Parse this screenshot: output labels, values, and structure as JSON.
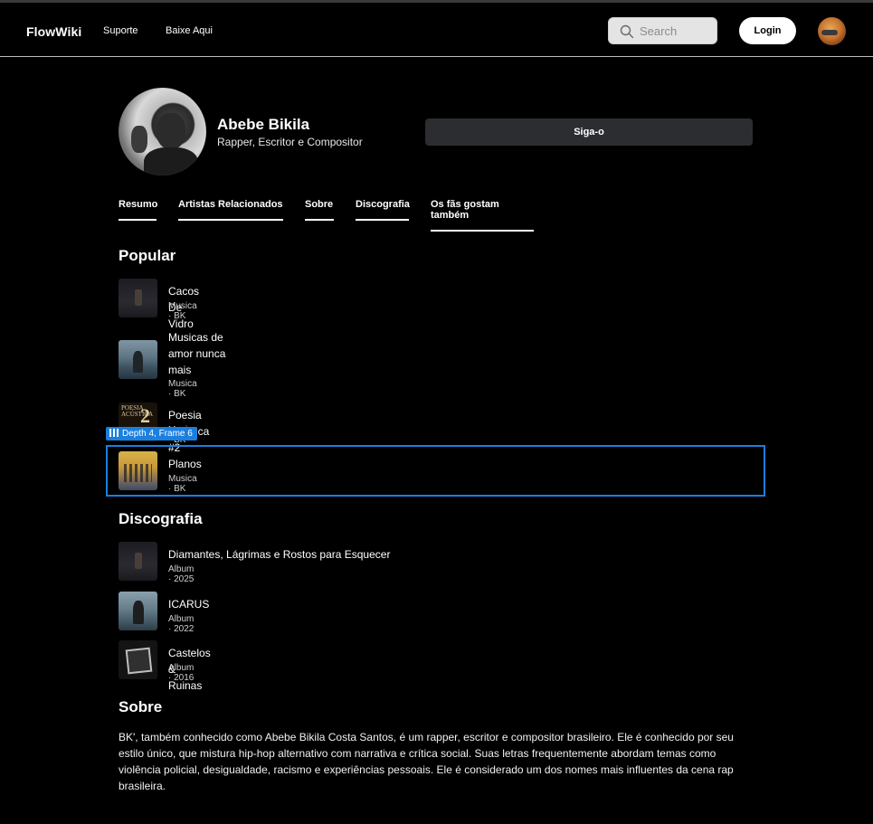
{
  "header": {
    "logo": "FlowWiki",
    "nav": [
      "Suporte",
      "Baixe Aqui"
    ],
    "search_placeholder": "Search",
    "login_label": "Login"
  },
  "profile": {
    "name": "Abebe Bikila",
    "role": "Rapper, Escritor e Compositor",
    "follow_label": "Siga-o"
  },
  "tabs": [
    "Resumo",
    "Artistas Relacionados",
    "Sobre",
    "Discografia",
    "Os fãs gostam também"
  ],
  "popular": {
    "title": "Popular",
    "items": [
      {
        "title": "Cacos De Vidro",
        "subtitle": "Musica · BK"
      },
      {
        "title": "Musicas de amor nunca mais",
        "subtitle": "Musica · BK"
      },
      {
        "title": "Poesia Acústica #2",
        "subtitle": "Musica · BK",
        "cover_text": "POESIA ACÚSTICA",
        "cover_number": "2"
      },
      {
        "title": "Planos",
        "subtitle": "Musica · BK"
      }
    ]
  },
  "selection_badge": "Depth 4, Frame 6",
  "discography": {
    "title": "Discografia",
    "items": [
      {
        "title": "Diamantes, Lágrimas e Rostos para Esquecer",
        "subtitle": "Album · 2025"
      },
      {
        "title": "ICARUS",
        "subtitle": "Album · 2022"
      },
      {
        "title": "Castelos & Ruinas",
        "subtitle": "Album · 2016"
      }
    ]
  },
  "about": {
    "title": "Sobre",
    "text": "BK', também conhecido como Abebe Bikila Costa Santos, é um rapper, escritor e compositor brasileiro. Ele é conhecido por seu estilo único, que mistura hip-hop alternativo com narrativa e crítica social. Suas letras frequentemente abordam temas como violência policial, desigualdade, racismo e experiências pessoais. Ele é considerado um dos nomes mais influentes da cena rap brasileira."
  },
  "colors": {
    "background": "#000000",
    "follow_button": "#2c2d31",
    "selection": "#1b7fe0"
  }
}
